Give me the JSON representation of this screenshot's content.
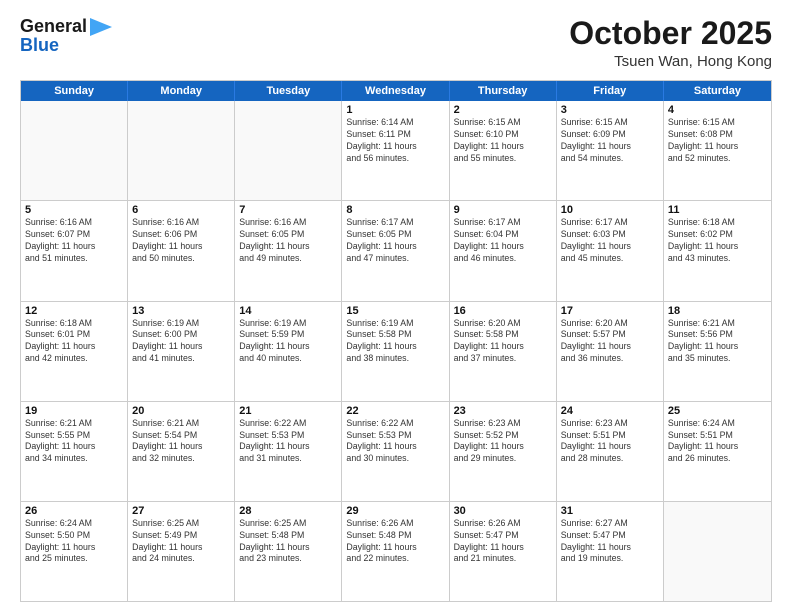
{
  "header": {
    "logo_line1": "General",
    "logo_line2": "Blue",
    "month": "October 2025",
    "location": "Tsuen Wan, Hong Kong"
  },
  "weekdays": [
    "Sunday",
    "Monday",
    "Tuesday",
    "Wednesday",
    "Thursday",
    "Friday",
    "Saturday"
  ],
  "rows": [
    [
      {
        "day": "",
        "info": ""
      },
      {
        "day": "",
        "info": ""
      },
      {
        "day": "",
        "info": ""
      },
      {
        "day": "1",
        "info": "Sunrise: 6:14 AM\nSunset: 6:11 PM\nDaylight: 11 hours\nand 56 minutes."
      },
      {
        "day": "2",
        "info": "Sunrise: 6:15 AM\nSunset: 6:10 PM\nDaylight: 11 hours\nand 55 minutes."
      },
      {
        "day": "3",
        "info": "Sunrise: 6:15 AM\nSunset: 6:09 PM\nDaylight: 11 hours\nand 54 minutes."
      },
      {
        "day": "4",
        "info": "Sunrise: 6:15 AM\nSunset: 6:08 PM\nDaylight: 11 hours\nand 52 minutes."
      }
    ],
    [
      {
        "day": "5",
        "info": "Sunrise: 6:16 AM\nSunset: 6:07 PM\nDaylight: 11 hours\nand 51 minutes."
      },
      {
        "day": "6",
        "info": "Sunrise: 6:16 AM\nSunset: 6:06 PM\nDaylight: 11 hours\nand 50 minutes."
      },
      {
        "day": "7",
        "info": "Sunrise: 6:16 AM\nSunset: 6:05 PM\nDaylight: 11 hours\nand 49 minutes."
      },
      {
        "day": "8",
        "info": "Sunrise: 6:17 AM\nSunset: 6:05 PM\nDaylight: 11 hours\nand 47 minutes."
      },
      {
        "day": "9",
        "info": "Sunrise: 6:17 AM\nSunset: 6:04 PM\nDaylight: 11 hours\nand 46 minutes."
      },
      {
        "day": "10",
        "info": "Sunrise: 6:17 AM\nSunset: 6:03 PM\nDaylight: 11 hours\nand 45 minutes."
      },
      {
        "day": "11",
        "info": "Sunrise: 6:18 AM\nSunset: 6:02 PM\nDaylight: 11 hours\nand 43 minutes."
      }
    ],
    [
      {
        "day": "12",
        "info": "Sunrise: 6:18 AM\nSunset: 6:01 PM\nDaylight: 11 hours\nand 42 minutes."
      },
      {
        "day": "13",
        "info": "Sunrise: 6:19 AM\nSunset: 6:00 PM\nDaylight: 11 hours\nand 41 minutes."
      },
      {
        "day": "14",
        "info": "Sunrise: 6:19 AM\nSunset: 5:59 PM\nDaylight: 11 hours\nand 40 minutes."
      },
      {
        "day": "15",
        "info": "Sunrise: 6:19 AM\nSunset: 5:58 PM\nDaylight: 11 hours\nand 38 minutes."
      },
      {
        "day": "16",
        "info": "Sunrise: 6:20 AM\nSunset: 5:58 PM\nDaylight: 11 hours\nand 37 minutes."
      },
      {
        "day": "17",
        "info": "Sunrise: 6:20 AM\nSunset: 5:57 PM\nDaylight: 11 hours\nand 36 minutes."
      },
      {
        "day": "18",
        "info": "Sunrise: 6:21 AM\nSunset: 5:56 PM\nDaylight: 11 hours\nand 35 minutes."
      }
    ],
    [
      {
        "day": "19",
        "info": "Sunrise: 6:21 AM\nSunset: 5:55 PM\nDaylight: 11 hours\nand 34 minutes."
      },
      {
        "day": "20",
        "info": "Sunrise: 6:21 AM\nSunset: 5:54 PM\nDaylight: 11 hours\nand 32 minutes."
      },
      {
        "day": "21",
        "info": "Sunrise: 6:22 AM\nSunset: 5:53 PM\nDaylight: 11 hours\nand 31 minutes."
      },
      {
        "day": "22",
        "info": "Sunrise: 6:22 AM\nSunset: 5:53 PM\nDaylight: 11 hours\nand 30 minutes."
      },
      {
        "day": "23",
        "info": "Sunrise: 6:23 AM\nSunset: 5:52 PM\nDaylight: 11 hours\nand 29 minutes."
      },
      {
        "day": "24",
        "info": "Sunrise: 6:23 AM\nSunset: 5:51 PM\nDaylight: 11 hours\nand 28 minutes."
      },
      {
        "day": "25",
        "info": "Sunrise: 6:24 AM\nSunset: 5:51 PM\nDaylight: 11 hours\nand 26 minutes."
      }
    ],
    [
      {
        "day": "26",
        "info": "Sunrise: 6:24 AM\nSunset: 5:50 PM\nDaylight: 11 hours\nand 25 minutes."
      },
      {
        "day": "27",
        "info": "Sunrise: 6:25 AM\nSunset: 5:49 PM\nDaylight: 11 hours\nand 24 minutes."
      },
      {
        "day": "28",
        "info": "Sunrise: 6:25 AM\nSunset: 5:48 PM\nDaylight: 11 hours\nand 23 minutes."
      },
      {
        "day": "29",
        "info": "Sunrise: 6:26 AM\nSunset: 5:48 PM\nDaylight: 11 hours\nand 22 minutes."
      },
      {
        "day": "30",
        "info": "Sunrise: 6:26 AM\nSunset: 5:47 PM\nDaylight: 11 hours\nand 21 minutes."
      },
      {
        "day": "31",
        "info": "Sunrise: 6:27 AM\nSunset: 5:47 PM\nDaylight: 11 hours\nand 19 minutes."
      },
      {
        "day": "",
        "info": ""
      }
    ]
  ],
  "colors": {
    "header_bg": "#1565c0",
    "header_text": "#ffffff",
    "border": "#cccccc",
    "empty_bg": "#f9f9f9"
  }
}
